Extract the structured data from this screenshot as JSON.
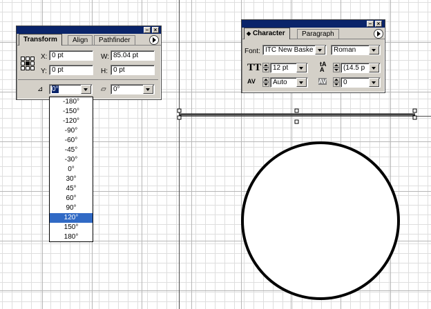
{
  "transform_panel": {
    "tabs": [
      "Transform",
      "Align",
      "Pathfinder"
    ],
    "x_label": "X:",
    "x_value": "0 pt",
    "y_label": "Y:",
    "y_value": "0 pt",
    "w_label": "W:",
    "w_value": "85.04 pt",
    "h_label": "H:",
    "h_value": "0 pt",
    "rotate_value": "0°",
    "shear_value": "0°",
    "rotate_options": [
      "-180°",
      "-150°",
      "-120°",
      "-90°",
      "-60°",
      "-45°",
      "-30°",
      "0°",
      "30°",
      "45°",
      "60°",
      "90°",
      "120°",
      "150°",
      "180°"
    ],
    "highlighted_option": "120°"
  },
  "character_panel": {
    "tabs": [
      "Character",
      "Paragraph"
    ],
    "font_label": "Font:",
    "font_value": "ITC New Baske",
    "style_value": "Roman",
    "size_value": "12 pt",
    "leading_value": "(14.5 p",
    "kerning_value": "Auto",
    "tracking_value": "0"
  },
  "icons": {
    "panel_menu": "panel-menu-arrow-icon",
    "reference_point": "reference-point-grid-icon",
    "rotate": "rotate-angle-icon",
    "shear": "shear-angle-icon",
    "font_size": "font-size-icon",
    "leading": "leading-icon",
    "kerning": "kerning-icon",
    "tracking": "tracking-icon"
  },
  "colors": {
    "titlebar": "#0a246a",
    "panel_bg": "#d4d0c8",
    "list_highlight": "#316ac5"
  }
}
